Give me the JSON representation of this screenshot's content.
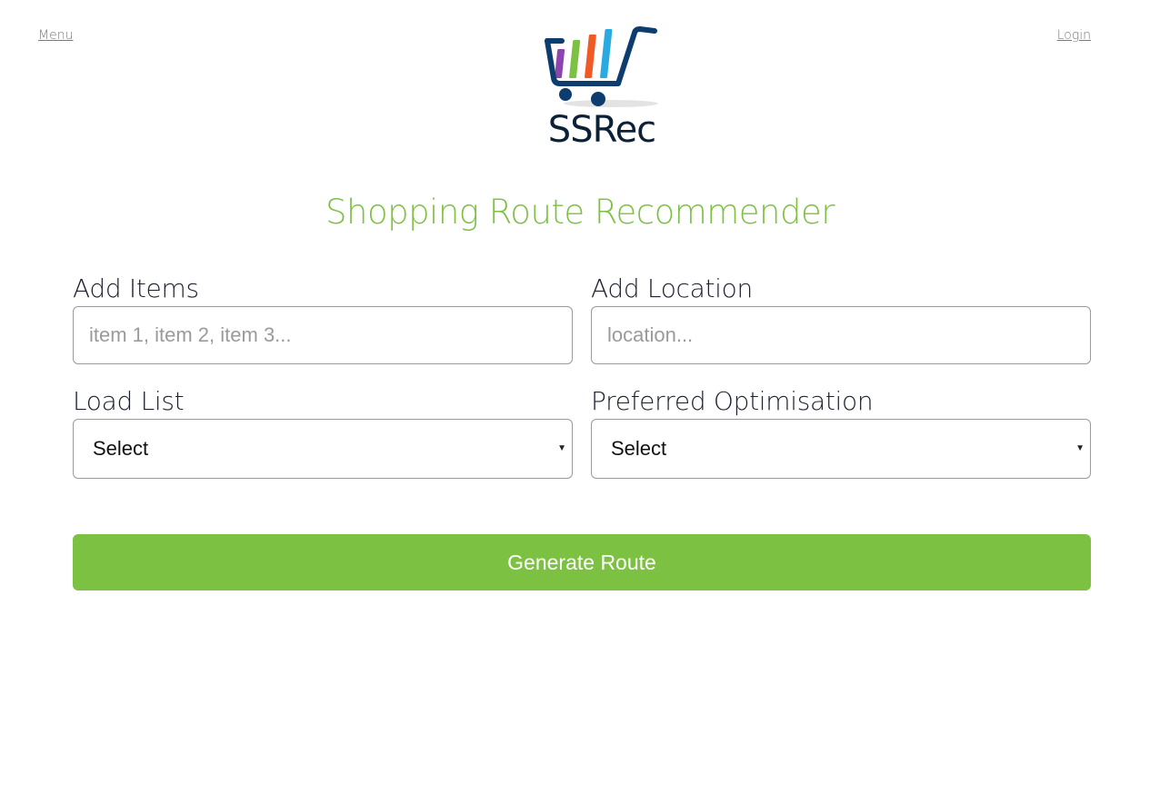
{
  "header": {
    "menu_label": "Menu",
    "login_label": "Login"
  },
  "logo": {
    "text": "SSRec",
    "icon": "shopping-cart-icon",
    "bar_colors": [
      "#8e44ad",
      "#7dc142",
      "#f15a24",
      "#29abe2"
    ],
    "cart_color": "#0d3c6e"
  },
  "page": {
    "title": "Shopping Route Recommender"
  },
  "form": {
    "items": {
      "label": "Add Items",
      "placeholder": "item 1, item 2, item 3..."
    },
    "location": {
      "label": "Add Location",
      "placeholder": "location..."
    },
    "load_list": {
      "label": "Load List",
      "selected": "Select"
    },
    "optimisation": {
      "label": "Preferred Optimisation",
      "selected": "Select"
    },
    "submit_label": "Generate Route"
  },
  "colors": {
    "accent": "#7dc142",
    "text": "#1b1f2e",
    "border": "#9a9a9a"
  }
}
